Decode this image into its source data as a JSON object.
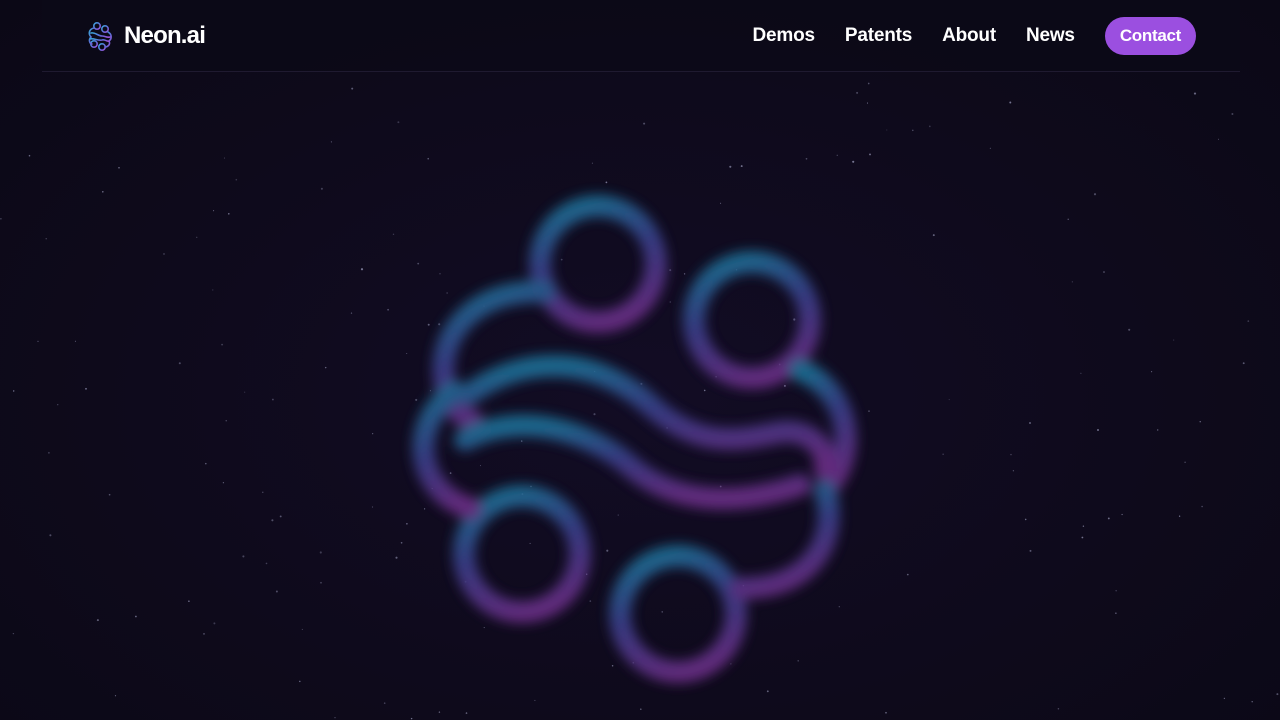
{
  "brand": {
    "name": "Neon.ai",
    "icon": "neon-brain-icon"
  },
  "nav": {
    "links": [
      "Demos",
      "Patents",
      "About",
      "News"
    ],
    "contact_label": "Contact"
  },
  "hero": {
    "graphic": "blurred-neon-brain-logo"
  },
  "colors": {
    "background": "#0e0a1b",
    "accent": "#9b4fe0",
    "glow_cyan": "#1f6f96",
    "glow_indigo": "#3a3f8a",
    "glow_purple": "#6a2e86"
  }
}
